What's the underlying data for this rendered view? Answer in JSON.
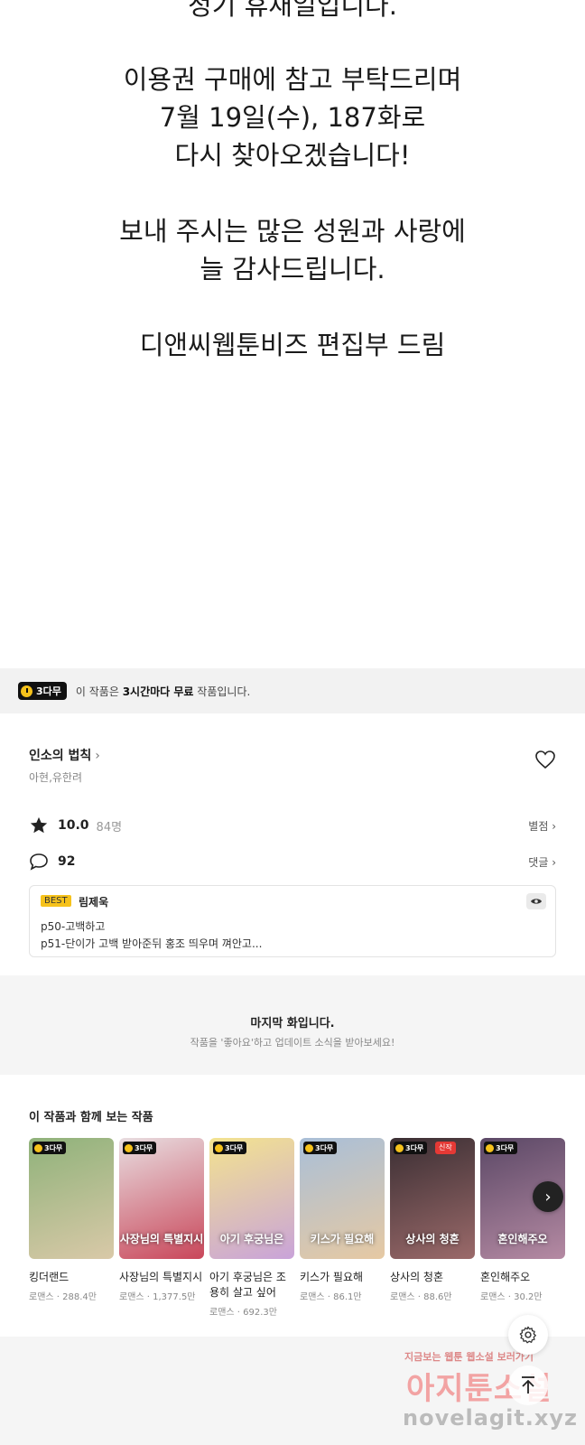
{
  "notice": {
    "lines": [
      "정기 휴재일입니다.",
      "이용권 구매에 참고 부탁드리며",
      "7월 19일(수), 187화로",
      "다시 찾아오겠습니다!",
      "보내 주시는 많은 성원과 사랑에",
      "늘 감사드립니다.",
      "디앤씨웹툰비즈 편집부 드림"
    ]
  },
  "free_banner": {
    "badge": "3다무",
    "text_prefix": "이 작품은 ",
    "text_bold": "3시간마다 무료",
    "text_suffix": " 작품입니다."
  },
  "work": {
    "title": "인소의 법칙",
    "authors": "아현,유한려",
    "rating": "10.0",
    "rating_count": "84명",
    "rating_link": "별점",
    "comment_count": "92",
    "comment_link": "댓글",
    "best_comment": {
      "tag": "BEST",
      "author": "림제욱",
      "line1": "p50-고백하고",
      "line2": "p51-단이가 고백 받아준뒤 홍조 띄우며 껴안고..."
    }
  },
  "last_episode": {
    "title": "마지막 화입니다.",
    "subtitle": "작품을 '좋아요'하고 업데이트 소식을 받아보세요!"
  },
  "recommend": {
    "title": "이 작품과 함께 보는 작품",
    "items": [
      {
        "title": "킹더랜드",
        "meta": "로맨스 · 288.4만",
        "badge": "3다무",
        "new": "",
        "cover": "",
        "color1": "#8fb27a",
        "color2": "#d9c9a8"
      },
      {
        "title": "사장님의 특별지시",
        "meta": "로맨스 · 1,377.5만",
        "badge": "3다무",
        "new": "",
        "cover": "사장님의 특별지시",
        "color1": "#e8dde0",
        "color2": "#c9475a"
      },
      {
        "title": "아기 후궁님은 조용히 살고 싶어",
        "meta": "로맨스 · 692.3만",
        "badge": "3다무",
        "new": "",
        "cover": "아기 후궁님은",
        "color1": "#f3e38f",
        "color2": "#c9a3d9"
      },
      {
        "title": "키스가 필요해",
        "meta": "로맨스 · 86.1만",
        "badge": "3다무",
        "new": "",
        "cover": "키스가 필요해",
        "color1": "#a9bfd8",
        "color2": "#e6c9a3"
      },
      {
        "title": "상사의 청혼",
        "meta": "로맨스 · 88.6만",
        "badge": "3다무",
        "new": "신작",
        "cover": "상사의 청혼",
        "color1": "#3a2e33",
        "color2": "#9b6a6a"
      },
      {
        "title": "혼인해주오",
        "meta": "로맨스 · 30.2만",
        "badge": "3다무",
        "new": "",
        "cover": "혼인해주오",
        "color1": "#5b4866",
        "color2": "#b58aa3"
      }
    ]
  },
  "watermark": {
    "line1": "지금보는 웹툰 웹소설 보러가기",
    "line2": "아지툰소설",
    "line3": "novelagit.xyz"
  }
}
